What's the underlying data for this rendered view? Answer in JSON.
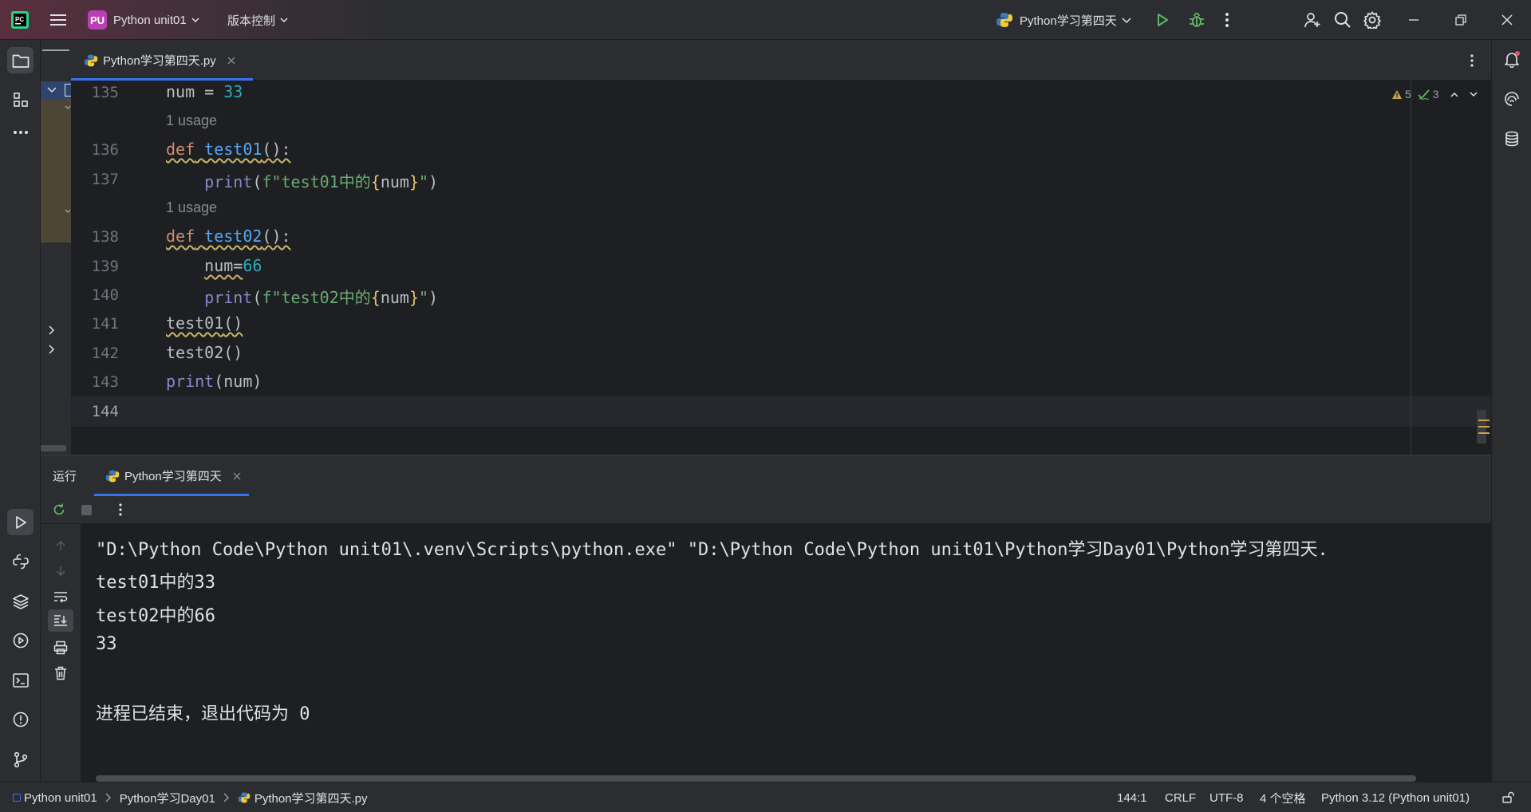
{
  "titlebar": {
    "project_badge": "PU",
    "project_name": "Python unit01",
    "vcs_label": "版本控制",
    "run_config": "Python学习第四天"
  },
  "editor": {
    "tab_label": "Python学习第四天.py",
    "inspection_warnings": "5",
    "inspection_checks": "3",
    "usage_label": "1 usage",
    "lines": {
      "l135": {
        "num": "135"
      },
      "l136": {
        "num": "136"
      },
      "l137": {
        "num": "137"
      },
      "l138": {
        "num": "138"
      },
      "l139": {
        "num": "139"
      },
      "l140": {
        "num": "140"
      },
      "l141": {
        "num": "141"
      },
      "l142": {
        "num": "142"
      },
      "l143": {
        "num": "143"
      },
      "l144": {
        "num": "144"
      }
    },
    "code": {
      "num_var": "num",
      "assign": " = ",
      "val33": "33",
      "def": "def",
      "test01": "test01",
      "test02": "test02",
      "sig_tail": "():",
      "print": "print",
      "fstr_prefix1": "f\"test01中的",
      "fstr_prefix2": "f\"test02中的",
      "brace_open": "{",
      "brace_close": "}",
      "fstr_end": "\"",
      "paren_open": "(",
      "paren_close": ")",
      "call_parens": "()",
      "num_eq": "num=",
      "val66": "66",
      "indent": "    "
    }
  },
  "run_panel": {
    "title": "运行",
    "tab_label": "Python学习第四天",
    "console": [
      "\"D:\\Python Code\\Python unit01\\.venv\\Scripts\\python.exe\" \"D:\\Python Code\\Python unit01\\Python学习Day01\\Python学习第四天.",
      "test01中的33",
      "test02中的66",
      "33",
      "",
      "进程已结束，退出代码为 0"
    ]
  },
  "statusbar": {
    "breadcrumb": [
      "Python unit01",
      "Python学习Day01",
      "Python学习第四天.py"
    ],
    "position": "144:1",
    "line_sep": "CRLF",
    "encoding": "UTF-8",
    "indent": "4 个空格",
    "interpreter": "Python 3.12 (Python unit01)"
  },
  "colors": {
    "accent": "#3574f0",
    "run_green": "#5fb865",
    "project_badge": "#b93fb4"
  }
}
